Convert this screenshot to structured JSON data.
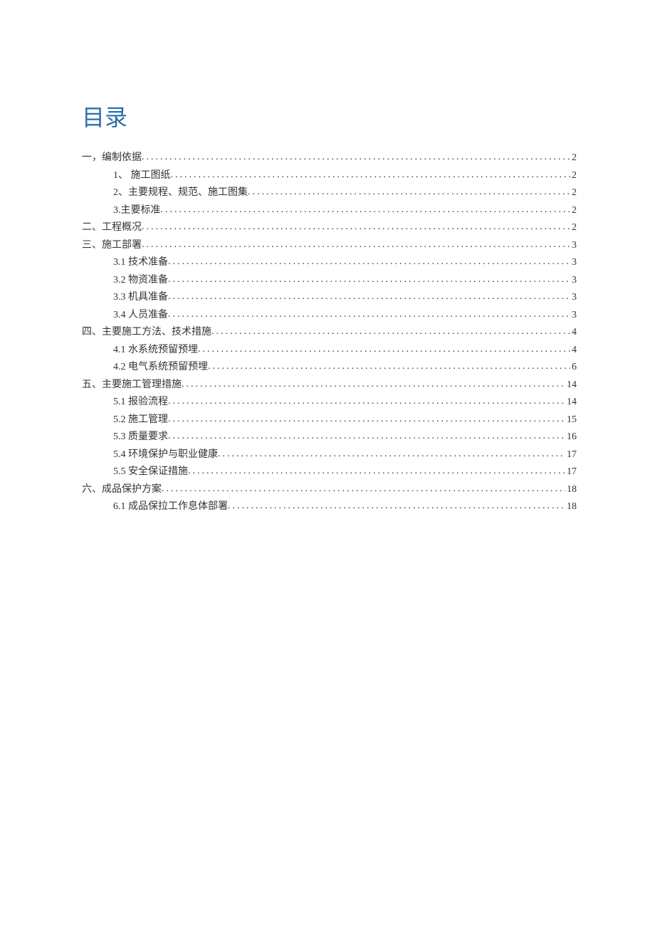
{
  "title": "目录",
  "toc": [
    {
      "level": 1,
      "label": "一，编制依据",
      "page": "2"
    },
    {
      "level": 2,
      "label": "1、 施工图纸",
      "page": "2"
    },
    {
      "level": 2,
      "label": "2、主要规程、规范、施工图集",
      "page": "2"
    },
    {
      "level": 2,
      "label": "3.主要标准",
      "page": "2"
    },
    {
      "level": 1,
      "label": "二、工程概况",
      "page": "2"
    },
    {
      "level": 1,
      "label": "三、施工部署",
      "page": "3"
    },
    {
      "level": 2,
      "label": "3.1 技术准备",
      "page": "3"
    },
    {
      "level": 2,
      "label": "3.2 物资准备",
      "page": "3"
    },
    {
      "level": 2,
      "label": "3.3 机具准备",
      "page": "3"
    },
    {
      "level": 2,
      "label": "3.4 人员准备",
      "page": "3"
    },
    {
      "level": 1,
      "label": "四、主要施工方法、技术措施",
      "page": "4"
    },
    {
      "level": 2,
      "label": "4.1 水系统预留预埋",
      "page": "4"
    },
    {
      "level": 2,
      "label": "4.2 电气系统预留预埋",
      "page": "6"
    },
    {
      "level": 1,
      "label": "五、主要施工管理措施",
      "page": "14"
    },
    {
      "level": 2,
      "label": "5.1 报验流程",
      "page": "14"
    },
    {
      "level": 2,
      "label": "5.2 施工管理",
      "page": "15"
    },
    {
      "level": 2,
      "label": "5.3 质量要求",
      "page": "16"
    },
    {
      "level": 2,
      "label": "5.4 环境保护与职业健康",
      "page": "17"
    },
    {
      "level": 2,
      "label": "5.5 安全保证措施",
      "page": "17"
    },
    {
      "level": 1,
      "label": "六、成品保护方案",
      "page": "18"
    },
    {
      "level": 2,
      "label": "6.1 成品保拉工作息体部署",
      "page": "18"
    }
  ]
}
